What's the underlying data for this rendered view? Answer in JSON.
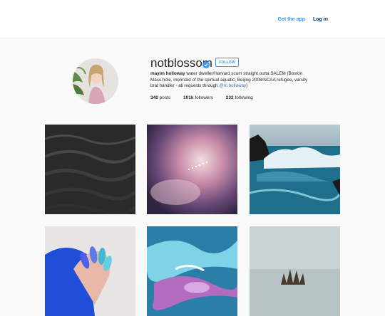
{
  "header": {
    "get_app": "Get the app",
    "log_in": "Log in"
  },
  "profile": {
    "username": "notblossom",
    "follow": "FOLLOW",
    "full_name": "mayim holloway",
    "bio": "water dweller/Harvard scum straight outta SALEM (Boston Mass.hole, mermaid of the spirtual aquatic, Beijing 2008/NCAA refugee, varsity brat handler - all requests through",
    "bio_link": "@m.holloway",
    "bio_end": ")",
    "posts_count": "340",
    "posts_label": "posts",
    "followers_count": "101k",
    "followers_label": "followers",
    "following_count": "232",
    "following_label": "following"
  },
  "colors": {
    "accent": "#3897f0",
    "link": "#3f729b",
    "verified": "#3897f0"
  }
}
